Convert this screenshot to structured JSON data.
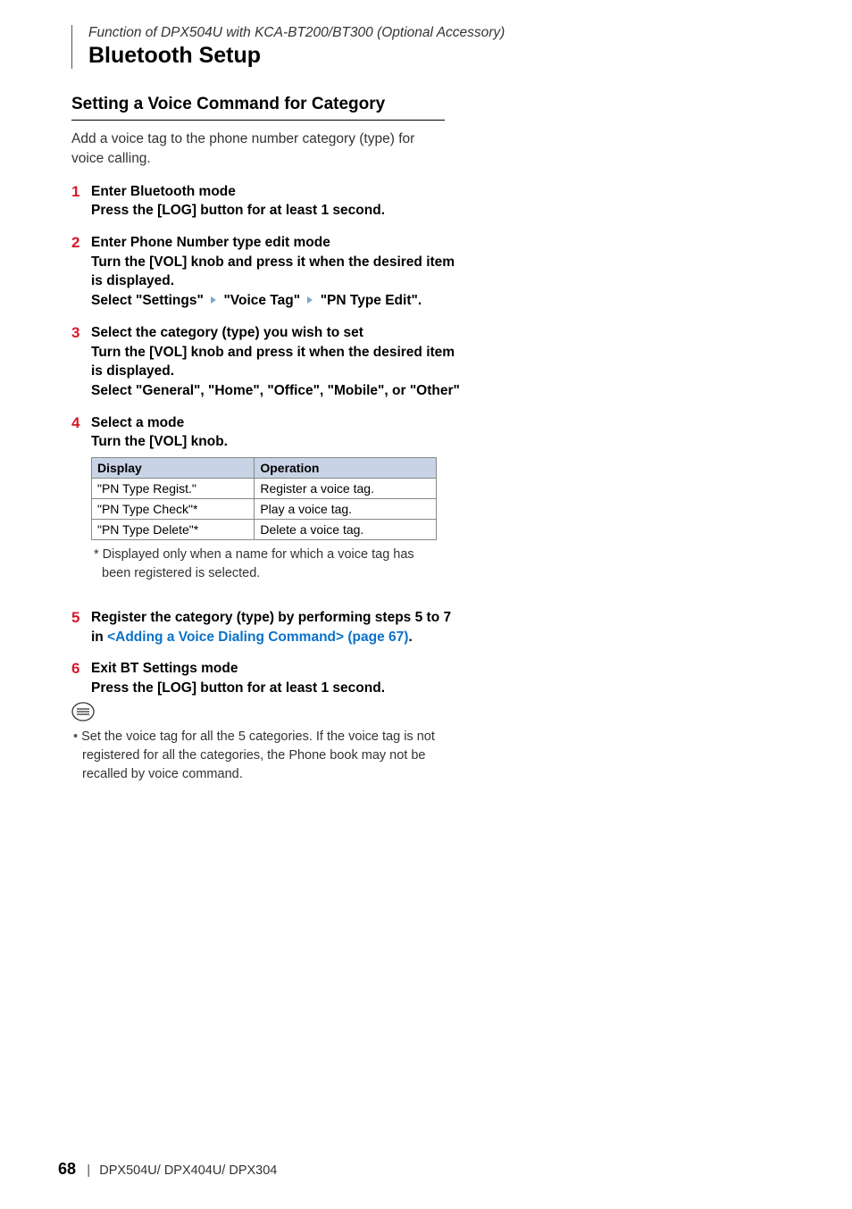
{
  "header": {
    "context": "Function of DPX504U with KCA-BT200/BT300 (Optional Accessory)",
    "title": "Bluetooth Setup"
  },
  "section": {
    "title": "Setting a Voice Command for Category",
    "intro": "Add a voice tag to the phone number category (type) for voice calling."
  },
  "steps": {
    "s1": {
      "num": "1",
      "heading": "Enter Bluetooth mode",
      "instr": "Press the [LOG] button for at least 1 second."
    },
    "s2": {
      "num": "2",
      "heading": "Enter Phone Number type edit mode",
      "instr1": "Turn the [VOL] knob and press it when the desired item is displayed.",
      "sel_a": "Select \"Settings\"",
      "sel_b": "\"Voice Tag\"",
      "sel_c": "\"PN Type Edit\"."
    },
    "s3": {
      "num": "3",
      "heading": "Select the category (type) you wish to set",
      "instr1": "Turn the [VOL] knob and press it when the desired item is displayed.",
      "instr2": "Select \"General\", \"Home\", \"Office\", \"Mobile\", or \"Other\""
    },
    "s4": {
      "num": "4",
      "heading": "Select a mode",
      "instr": "Turn the [VOL] knob.",
      "table": {
        "h1": "Display",
        "h2": "Operation",
        "r1c1": "\"PN Type Regist.\"",
        "r1c2": "Register a voice tag.",
        "r2c1": "\"PN Type Check\"*",
        "r2c2": "Play a voice tag.",
        "r3c1": "\"PN Type Delete\"*",
        "r3c2": "Delete a voice tag."
      },
      "note": "* Displayed only when a name for which a voice tag has been registered is selected."
    },
    "s5": {
      "num": "5",
      "heading_a": "Register the category (type) by performing steps 5 to 7 in ",
      "link": "<Adding a Voice Dialing Command> (page 67)",
      "heading_b": "."
    },
    "s6": {
      "num": "6",
      "heading": "Exit BT Settings mode",
      "instr": "Press the [LOG] button for at least 1 second."
    }
  },
  "note_bullet": "Set the voice tag for all the 5 categories.  If the voice tag is not registered for all the categories, the Phone book may not be recalled by voice command.",
  "footer": {
    "page": "68",
    "models": "DPX504U/ DPX404U/ DPX304"
  }
}
